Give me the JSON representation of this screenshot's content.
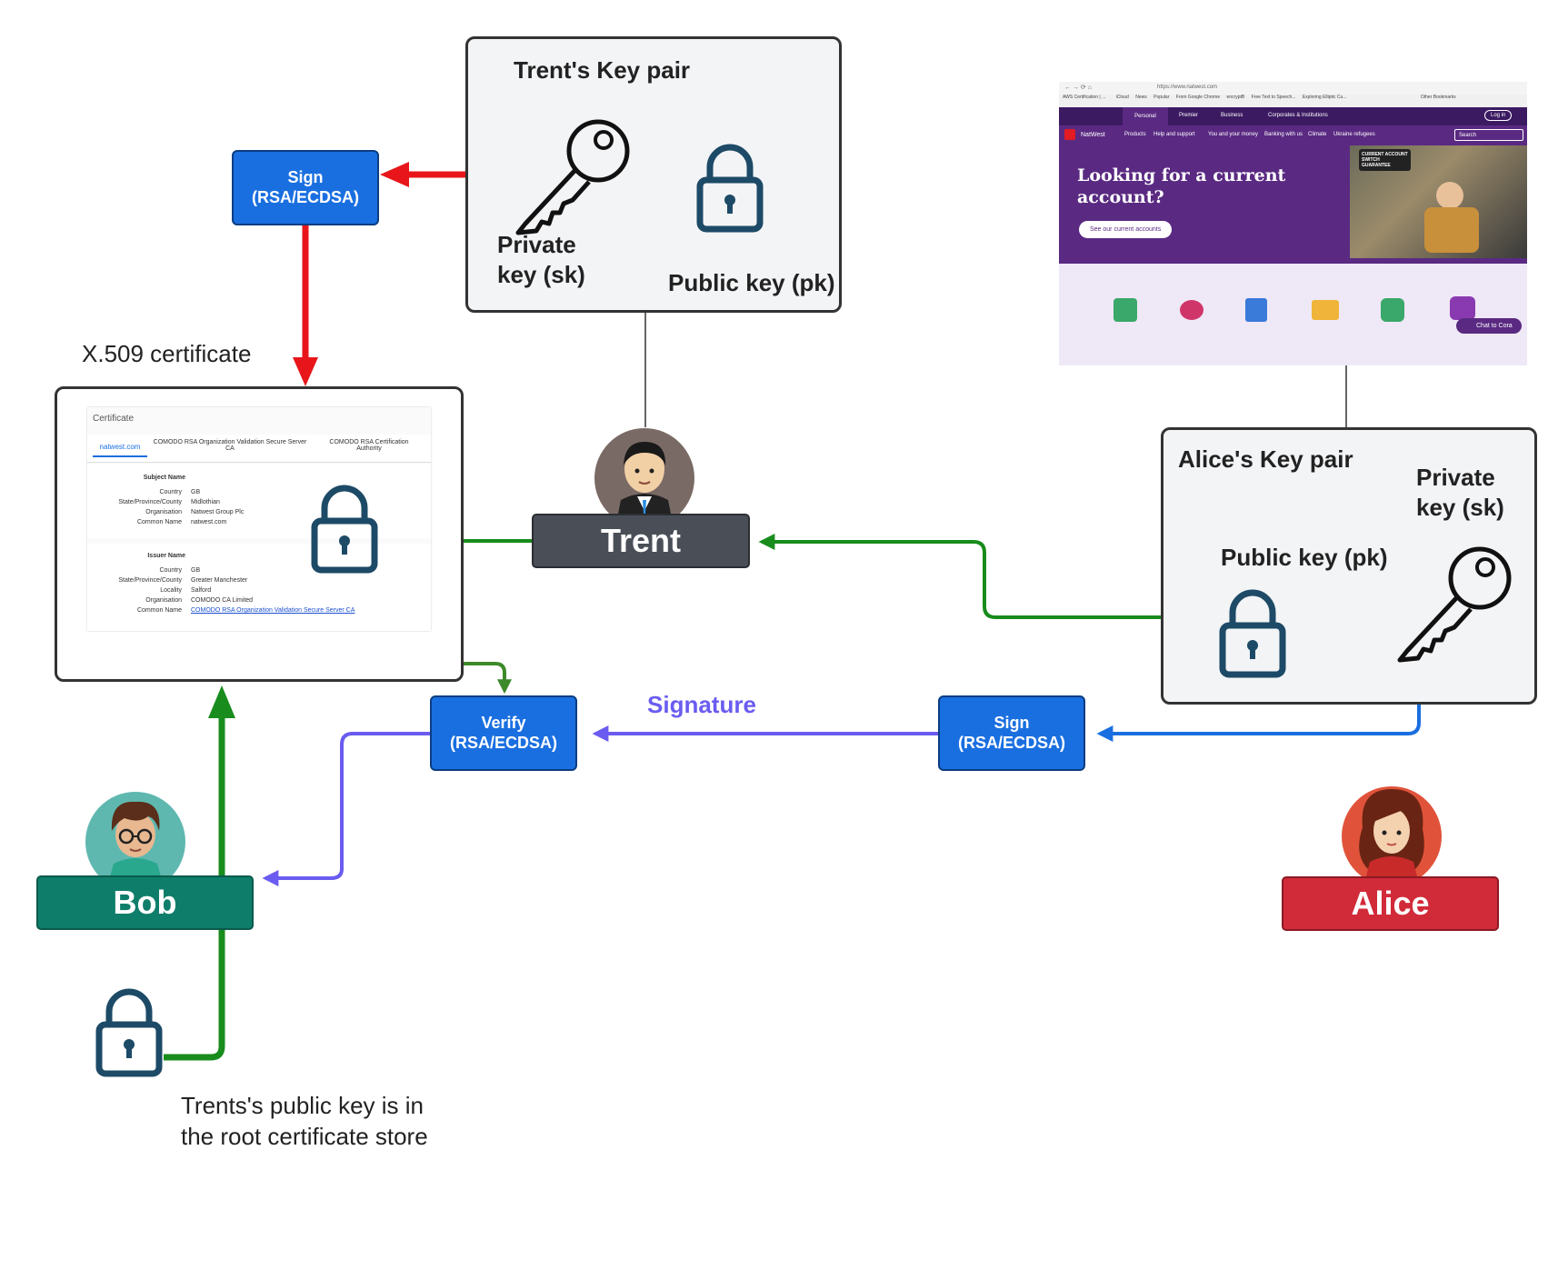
{
  "trent_keypair": {
    "title": "Trent's Key pair",
    "private_key": "Private\nkey (sk)",
    "public_key": "Public key (pk)"
  },
  "alice_keypair": {
    "title": "Alice's Key pair",
    "private_key": "Private\nkey (sk)",
    "public_key": "Public key (pk)"
  },
  "trent_sign": {
    "line1": "Sign",
    "line2": "(RSA/ECDSA)"
  },
  "alice_sign": {
    "line1": "Sign",
    "line2": "(RSA/ECDSA)"
  },
  "verify": {
    "line1": "Verify",
    "line2": "(RSA/ECDSA)"
  },
  "signature_label": "Signature",
  "certificate_caption": "X.509 certificate",
  "root_store_caption": "Trents's public key is in\nthe root certificate store",
  "people": {
    "trent": "Trent",
    "bob": "Bob",
    "alice": "Alice"
  },
  "certificate": {
    "header": "Certificate",
    "tabs": [
      "natwest.com",
      "COMODO RSA Organization Validation Secure Server CA",
      "COMODO RSA Certification Authority"
    ],
    "subject_heading": "Subject Name",
    "subject": [
      {
        "k": "Country",
        "v": "GB"
      },
      {
        "k": "State/Province/County",
        "v": "Midlothian"
      },
      {
        "k": "Organisation",
        "v": "Natwest Group Plc"
      },
      {
        "k": "Common Name",
        "v": "natwest.com"
      }
    ],
    "issuer_heading": "Issuer Name",
    "issuer": [
      {
        "k": "Country",
        "v": "GB"
      },
      {
        "k": "State/Province/County",
        "v": "Greater Manchester"
      },
      {
        "k": "Locality",
        "v": "Salford"
      },
      {
        "k": "Organisation",
        "v": "COMODO CA Limited"
      },
      {
        "k": "Common Name",
        "v": "COMODO RSA Organization Validation Secure Server CA"
      }
    ]
  },
  "website": {
    "url": "https://www.natwest.com",
    "bookmarks": [
      "AWS Certification | ...",
      "iCloud",
      "News",
      "Popular",
      "From Google Chrome",
      "encryptB",
      "Free Text to Speech...",
      "Exploring Elliptic Cu...",
      "Other Bookmarks"
    ],
    "top_tabs": [
      "Personal",
      "Premier",
      "Business",
      "Corporates & Institutions"
    ],
    "login": "Log in",
    "brand": "NatWest",
    "nav": [
      "Products",
      "Help and support",
      "You and your money",
      "Banking with us",
      "Climate",
      "Ukraine refugees"
    ],
    "search": "Search",
    "hero_title": "Looking for a current account?",
    "hero_button": "See our current accounts",
    "badge": "CURRENT ACCOUNT\nSWITCH\nGUARANTEE",
    "chat": "Chat to Cora"
  },
  "colors": {
    "red_arrow": "#e8161b",
    "green_arrow": "#188c1c",
    "purple_arrow": "#6a5cf0",
    "blue_arrow": "#1a6fe0",
    "trent_box": "#4a4f57",
    "bob_box": "#0e7e6a",
    "alice_box": "#d12b3a",
    "lock": "#1d4a66",
    "natwest_purple": "#5a2a82"
  }
}
